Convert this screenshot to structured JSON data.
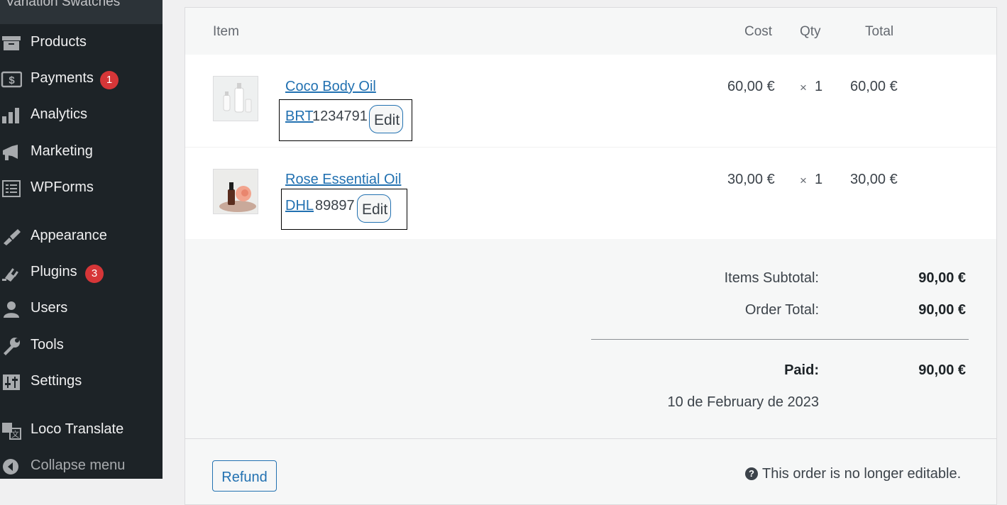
{
  "sidebar": {
    "top_item": "Variation Swatches",
    "items": [
      {
        "label": "Products",
        "icon": "archive-icon"
      },
      {
        "label": "Payments",
        "icon": "dollar-icon",
        "badge": "1"
      },
      {
        "label": "Analytics",
        "icon": "bar-chart-icon"
      },
      {
        "label": "Marketing",
        "icon": "megaphone-icon"
      },
      {
        "label": "WPForms",
        "icon": "forms-icon"
      },
      {
        "label": "Appearance",
        "icon": "paintbrush-icon"
      },
      {
        "label": "Plugins",
        "icon": "plug-icon",
        "badge": "3"
      },
      {
        "label": "Users",
        "icon": "user-icon"
      },
      {
        "label": "Tools",
        "icon": "wrench-icon"
      },
      {
        "label": "Settings",
        "icon": "sliders-icon"
      },
      {
        "label": "Loco Translate",
        "icon": "translate-icon"
      },
      {
        "label": "Collapse menu",
        "icon": "collapse-icon"
      }
    ]
  },
  "order": {
    "headers": {
      "item": "Item",
      "cost": "Cost",
      "qty": "Qty",
      "total": "Total"
    },
    "items": [
      {
        "name": "Coco Body Oil",
        "carrier": "BRT",
        "tracking": "1234791",
        "edit": "Edit",
        "cost": "60,00 €",
        "times": "×",
        "qty": "1",
        "total": "60,00 €"
      },
      {
        "name": "Rose Essential Oil",
        "carrier": "DHL",
        "tracking": "89897",
        "edit": "Edit",
        "cost": "30,00 €",
        "times": "×",
        "qty": "1",
        "total": "30,00 €"
      }
    ],
    "totals": {
      "subtotal_label": "Items Subtotal:",
      "subtotal_value": "90,00 €",
      "order_total_label": "Order Total:",
      "order_total_value": "90,00 €",
      "paid_label": "Paid:",
      "paid_value": "90,00 €",
      "paid_date": "10 de February de 2023"
    },
    "refund_label": "Refund",
    "not_editable_note": "This order is no longer editable."
  },
  "colors": {
    "sidebar_bg": "#1d2327",
    "accent": "#2271b1",
    "badge": "#d63638"
  }
}
